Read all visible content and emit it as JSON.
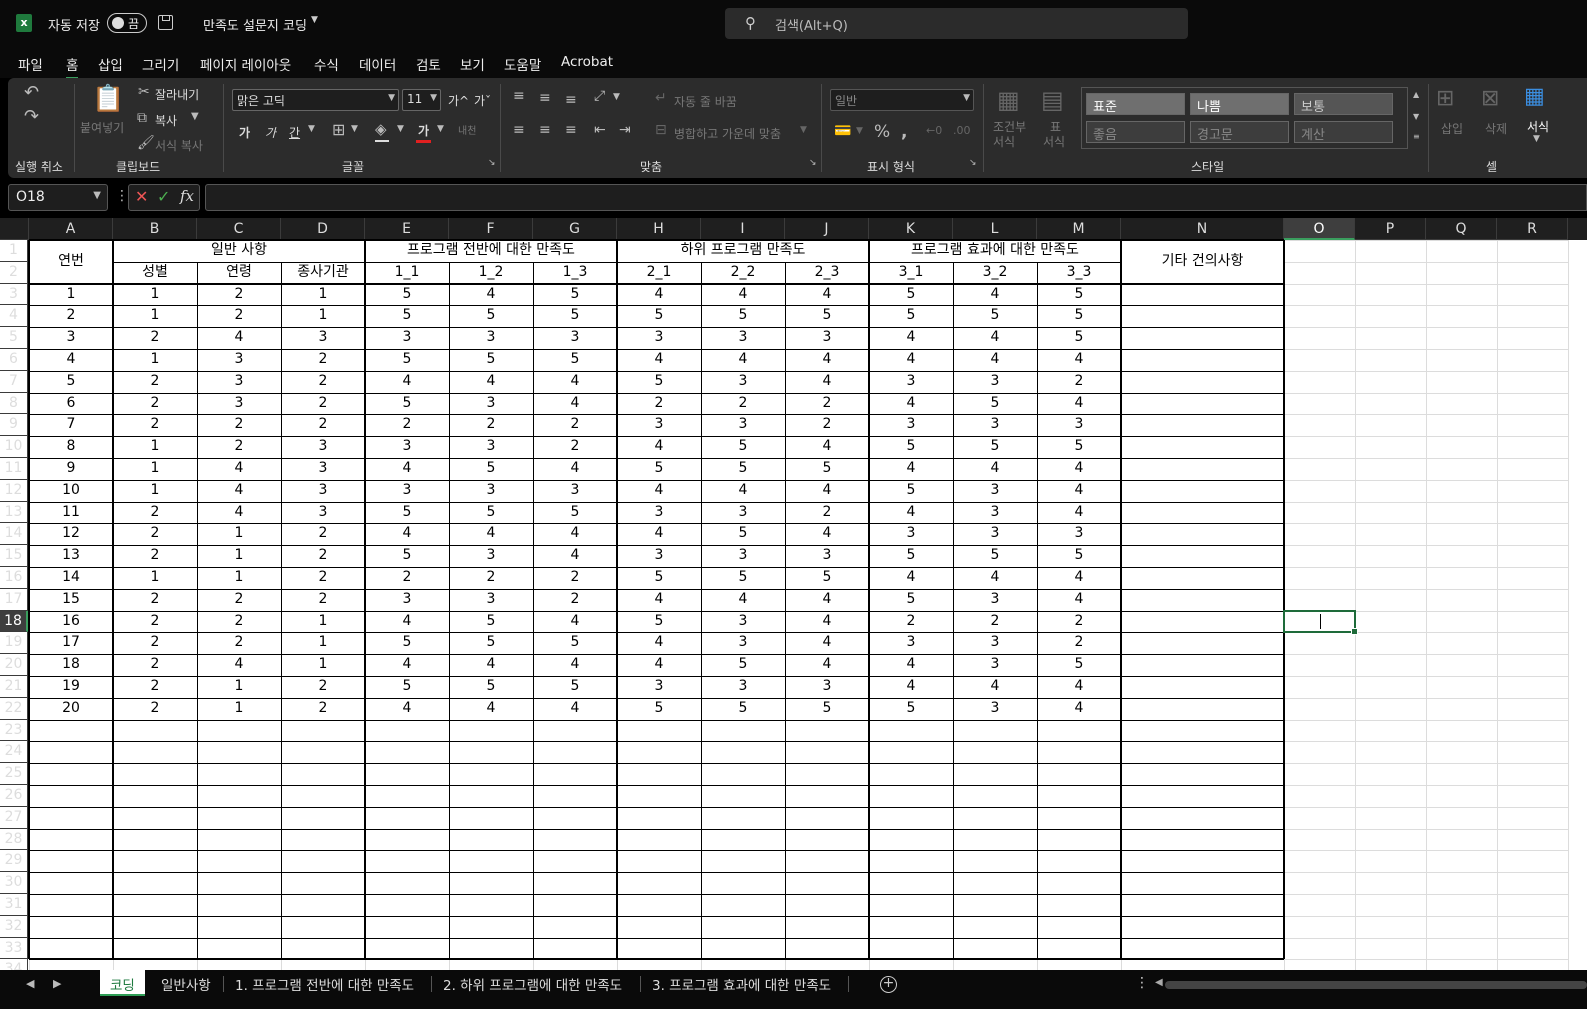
{
  "title_bar": {
    "autosave_label": "자동 저장",
    "autosave_state": "끔",
    "document_title": "만족도 설문지 코딩",
    "search_placeholder": "검색(Alt+Q)"
  },
  "menu": {
    "tabs": [
      "파일",
      "홈",
      "삽입",
      "그리기",
      "페이지 레이아웃",
      "수식",
      "데이터",
      "검토",
      "보기",
      "도움말",
      "Acrobat"
    ],
    "active": "홈"
  },
  "ribbon": {
    "groups": {
      "undo": "실행 취소",
      "clipboard": "클립보드",
      "font": "글꼴",
      "alignment": "맞춤",
      "number": "표시 형식",
      "styles": "스타일",
      "cells": "셀"
    },
    "clipboard": {
      "paste": "붙여넣기",
      "cut": "잘라내기",
      "copy": "복사",
      "format_painter": "서식 복사"
    },
    "font": {
      "name": "맑은 고딕",
      "size": "11",
      "bold": "가",
      "italic": "가",
      "underline": "간",
      "font_color": "가",
      "grow": "가^",
      "shrink": "가ˇ",
      "phonetic": "내천"
    },
    "alignment": {
      "wrap_text": "자동 줄 바꿈",
      "merge_center": "병합하고 가운데 맞춤"
    },
    "number": {
      "format": "일반"
    },
    "styles": {
      "conditional_line1": "조건부",
      "conditional_line2": "서식",
      "table_line1": "표",
      "table_line2": "서식",
      "cells": [
        {
          "label": "표준",
          "kind": "normal"
        },
        {
          "label": "나쁨",
          "kind": "normal"
        },
        {
          "label": "보통",
          "kind": "dim2"
        },
        {
          "label": "좋음",
          "kind": "dim"
        },
        {
          "label": "경고문",
          "kind": "dim"
        },
        {
          "label": "계산",
          "kind": "dim"
        }
      ]
    },
    "cells_group": {
      "insert": "삽입",
      "delete": "삭제",
      "format": "서식"
    }
  },
  "formula_bar": {
    "name_box": "O18",
    "fx_label": "fx",
    "formula": ""
  },
  "sheet": {
    "columns": [
      "A",
      "B",
      "C",
      "D",
      "E",
      "F",
      "G",
      "H",
      "I",
      "J",
      "K",
      "L",
      "M",
      "N",
      "O",
      "P",
      "Q",
      "R"
    ],
    "selected_column": "O",
    "selected_row": "18",
    "visible_rows": [
      "1",
      "2",
      "3",
      "4",
      "5",
      "6",
      "7",
      "8",
      "9",
      "10",
      "11",
      "12",
      "13",
      "14",
      "15",
      "16",
      "17",
      "18",
      "19",
      "20",
      "21",
      "22",
      "23",
      "24",
      "25",
      "26",
      "27",
      "28",
      "29",
      "30",
      "31",
      "32",
      "33",
      "34"
    ],
    "headers": {
      "serial": "연번",
      "general": "일반 사항",
      "gender": "성별",
      "age": "연령",
      "org": "종사기관",
      "program_overall": "프로그램 전반에 대한 만족도",
      "sub_program": "하위 프로그램 만족도",
      "program_effect": "프로그램 효과에 대한 만족도",
      "other": "기타 건의사항",
      "items": [
        "1_1",
        "1_2",
        "1_3",
        "2_1",
        "2_2",
        "2_3",
        "3_1",
        "3_2",
        "3_3"
      ]
    },
    "data_rows": [
      [
        "1",
        "1",
        "2",
        "1",
        "5",
        "4",
        "5",
        "4",
        "4",
        "4",
        "5",
        "4",
        "5"
      ],
      [
        "2",
        "1",
        "2",
        "1",
        "5",
        "5",
        "5",
        "5",
        "5",
        "5",
        "5",
        "5",
        "5"
      ],
      [
        "3",
        "2",
        "4",
        "3",
        "3",
        "3",
        "3",
        "3",
        "3",
        "3",
        "4",
        "4",
        "5"
      ],
      [
        "4",
        "1",
        "3",
        "2",
        "5",
        "5",
        "5",
        "4",
        "4",
        "4",
        "4",
        "4",
        "4"
      ],
      [
        "5",
        "2",
        "3",
        "2",
        "4",
        "4",
        "4",
        "5",
        "3",
        "4",
        "3",
        "3",
        "2"
      ],
      [
        "6",
        "2",
        "3",
        "2",
        "5",
        "3",
        "4",
        "2",
        "2",
        "2",
        "4",
        "5",
        "4"
      ],
      [
        "7",
        "2",
        "2",
        "2",
        "2",
        "2",
        "2",
        "3",
        "3",
        "2",
        "3",
        "3",
        "3"
      ],
      [
        "8",
        "1",
        "2",
        "3",
        "3",
        "3",
        "2",
        "4",
        "5",
        "4",
        "5",
        "5",
        "5"
      ],
      [
        "9",
        "1",
        "4",
        "3",
        "4",
        "5",
        "4",
        "5",
        "5",
        "5",
        "4",
        "4",
        "4"
      ],
      [
        "10",
        "1",
        "4",
        "3",
        "3",
        "3",
        "3",
        "4",
        "4",
        "4",
        "5",
        "3",
        "4"
      ],
      [
        "11",
        "2",
        "4",
        "3",
        "5",
        "5",
        "5",
        "3",
        "3",
        "2",
        "4",
        "3",
        "4"
      ],
      [
        "12",
        "2",
        "1",
        "2",
        "4",
        "4",
        "4",
        "4",
        "5",
        "4",
        "3",
        "3",
        "3"
      ],
      [
        "13",
        "2",
        "1",
        "2",
        "5",
        "3",
        "4",
        "3",
        "3",
        "3",
        "5",
        "5",
        "5"
      ],
      [
        "14",
        "1",
        "1",
        "2",
        "2",
        "2",
        "2",
        "5",
        "5",
        "5",
        "4",
        "4",
        "4"
      ],
      [
        "15",
        "2",
        "2",
        "2",
        "3",
        "3",
        "2",
        "4",
        "4",
        "4",
        "5",
        "3",
        "4"
      ],
      [
        "16",
        "2",
        "2",
        "1",
        "4",
        "5",
        "4",
        "5",
        "3",
        "4",
        "2",
        "2",
        "2"
      ],
      [
        "17",
        "2",
        "2",
        "1",
        "5",
        "5",
        "5",
        "4",
        "3",
        "4",
        "3",
        "3",
        "2"
      ],
      [
        "18",
        "2",
        "4",
        "1",
        "4",
        "4",
        "4",
        "4",
        "5",
        "4",
        "4",
        "3",
        "5"
      ],
      [
        "19",
        "2",
        "1",
        "2",
        "5",
        "5",
        "5",
        "3",
        "3",
        "3",
        "4",
        "4",
        "4"
      ],
      [
        "20",
        "2",
        "1",
        "2",
        "4",
        "4",
        "4",
        "5",
        "5",
        "5",
        "5",
        "3",
        "4"
      ]
    ]
  },
  "sheet_tabs": {
    "tabs": [
      "코딩",
      "일반사항",
      "1. 프로그램 전반에 대한 만족도",
      "2. 하위 프로그램에 대한 만족도",
      "3. 프로그램 효과에 대한 만족도"
    ],
    "active": "코딩"
  },
  "colors": {
    "accent": "#3a9e5e",
    "selection": "#1e6b3a",
    "ribbon_bg": "#2c2c2c",
    "titlebar_bg": "#0a0a0a"
  }
}
